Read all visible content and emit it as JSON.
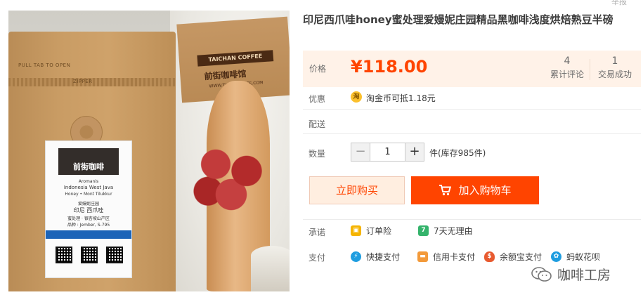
{
  "product": {
    "title": "印尼西爪哇honey蜜处理爱嫚妮庄园精品黑咖啡浅度烘焙熟豆半磅",
    "corner_text": "举报"
  },
  "photo": {
    "bag_pull_text": "PULL TAB TO OPEN",
    "bag_zipper_text": "ZIPPER",
    "label_brand": "前街咖啡",
    "label_lines": [
      "Aromanis",
      "Indonesia West Java",
      "Honey • Mont Tilukkur",
      "爱嫚妮庄园",
      "印尼 西爪哇",
      "蜜处理 · 银杏坡山产区",
      "品种 : Jember, S-795"
    ],
    "sign_brand_en": "TAICHAN COFFEE",
    "sign_brand_cn": "前街咖啡馆",
    "sign_url": "WWW.TAICHANCAFE.COM"
  },
  "price": {
    "label": "价格",
    "value": "¥118.00",
    "reviews_count": "4",
    "reviews_label": "累计评论",
    "sales_count": "1",
    "sales_label": "交易成功"
  },
  "promo": {
    "label": "优惠",
    "icon_text": "淘",
    "text": "淘金币可抵1.18元"
  },
  "delivery": {
    "label": "配送"
  },
  "quantity": {
    "label": "数量",
    "minus": "−",
    "plus": "+",
    "value": "1",
    "stock_text": "件(库存985件)"
  },
  "actions": {
    "buy_now": "立即购买",
    "add_to_cart": "加入购物车"
  },
  "commitment": {
    "label": "承诺",
    "items": [
      {
        "text": "订单险",
        "icon": "shield-icon",
        "color": "#f5b400"
      },
      {
        "text": "7天无理由",
        "icon": "seven-days-icon",
        "color": "#34b36b"
      }
    ]
  },
  "payment": {
    "label": "支付",
    "items": [
      {
        "text": "快捷支付",
        "icon": "quick-pay-icon",
        "color": "#1e9de0"
      },
      {
        "text": "信用卡支付",
        "icon": "credit-card-icon",
        "color": "#f39a3a"
      },
      {
        "text": "余额宝支付",
        "icon": "yuebao-icon",
        "color": "#e85a2f"
      },
      {
        "text": "蚂蚁花呗",
        "icon": "huabei-icon",
        "color": "#1e9de0"
      }
    ]
  },
  "watermark": {
    "text": "咖啡工房"
  },
  "colors": {
    "accent": "#ff4400",
    "price_bg": "#fff2e8",
    "buy_bg": "#ffeee0"
  }
}
